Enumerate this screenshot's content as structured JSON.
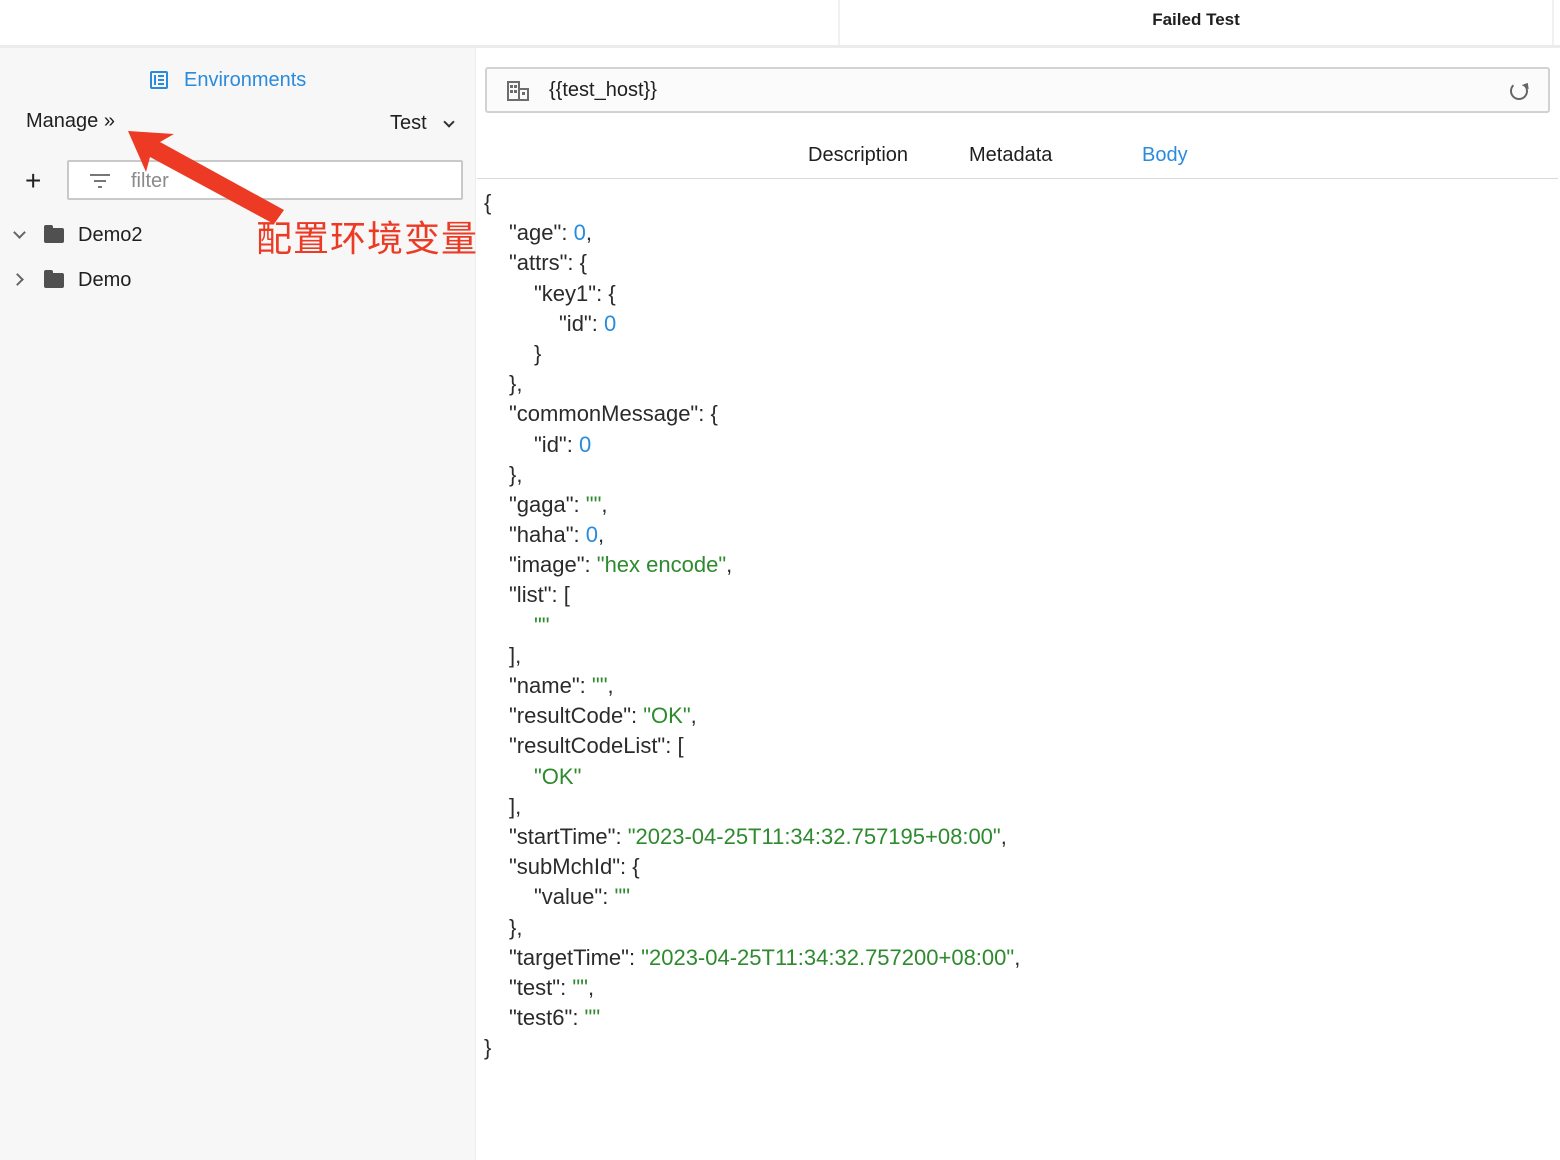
{
  "header": {
    "title": "Failed Test"
  },
  "sidebar": {
    "environments_label": "Environments",
    "manage_label": "Manage »",
    "environment_selected": "Test",
    "add_label": "+",
    "filter_placeholder": "filter",
    "tree": [
      {
        "label": "Demo2",
        "expanded": true
      },
      {
        "label": "Demo",
        "expanded": false
      }
    ]
  },
  "annotation": {
    "text": "配置环境变量",
    "color": "#ec3a24"
  },
  "request": {
    "url": "{{test_host}}"
  },
  "tabs": [
    {
      "label": "Description",
      "active": false
    },
    {
      "label": "Metadata",
      "active": false
    },
    {
      "label": "Body",
      "active": true
    }
  ],
  "colors": {
    "accent": "#2a8bdc",
    "string": "#2e8a2e",
    "number": "#2a8bdc"
  },
  "body_lines": [
    {
      "indent": 0,
      "parts": [
        {
          "t": "p",
          "v": "{"
        }
      ]
    },
    {
      "indent": 1,
      "parts": [
        {
          "t": "k",
          "v": "\"age\": "
        },
        {
          "t": "n",
          "v": "0"
        },
        {
          "t": "p",
          "v": ","
        }
      ]
    },
    {
      "indent": 1,
      "parts": [
        {
          "t": "k",
          "v": "\"attrs\": {"
        }
      ]
    },
    {
      "indent": 2,
      "parts": [
        {
          "t": "k",
          "v": "\"key1\": {"
        }
      ]
    },
    {
      "indent": 3,
      "parts": [
        {
          "t": "k",
          "v": "\"id\": "
        },
        {
          "t": "n",
          "v": "0"
        }
      ]
    },
    {
      "indent": 2,
      "parts": [
        {
          "t": "p",
          "v": "}"
        }
      ]
    },
    {
      "indent": 1,
      "parts": [
        {
          "t": "p",
          "v": "},"
        }
      ]
    },
    {
      "indent": 1,
      "parts": [
        {
          "t": "k",
          "v": "\"commonMessage\": {"
        }
      ]
    },
    {
      "indent": 2,
      "parts": [
        {
          "t": "k",
          "v": "\"id\": "
        },
        {
          "t": "n",
          "v": "0"
        }
      ]
    },
    {
      "indent": 1,
      "parts": [
        {
          "t": "p",
          "v": "},"
        }
      ]
    },
    {
      "indent": 1,
      "parts": [
        {
          "t": "k",
          "v": "\"gaga\": "
        },
        {
          "t": "s",
          "v": "\"\""
        },
        {
          "t": "p",
          "v": ","
        }
      ]
    },
    {
      "indent": 1,
      "parts": [
        {
          "t": "k",
          "v": "\"haha\": "
        },
        {
          "t": "n",
          "v": "0"
        },
        {
          "t": "p",
          "v": ","
        }
      ]
    },
    {
      "indent": 1,
      "parts": [
        {
          "t": "k",
          "v": "\"image\": "
        },
        {
          "t": "s",
          "v": "\"hex encode\""
        },
        {
          "t": "p",
          "v": ","
        }
      ]
    },
    {
      "indent": 1,
      "parts": [
        {
          "t": "k",
          "v": "\"list\": ["
        }
      ]
    },
    {
      "indent": 2,
      "parts": [
        {
          "t": "s",
          "v": "\"\""
        }
      ]
    },
    {
      "indent": 1,
      "parts": [
        {
          "t": "p",
          "v": "],"
        }
      ]
    },
    {
      "indent": 1,
      "parts": [
        {
          "t": "k",
          "v": "\"name\": "
        },
        {
          "t": "s",
          "v": "\"\""
        },
        {
          "t": "p",
          "v": ","
        }
      ]
    },
    {
      "indent": 1,
      "parts": [
        {
          "t": "k",
          "v": "\"resultCode\": "
        },
        {
          "t": "s",
          "v": "\"OK\""
        },
        {
          "t": "p",
          "v": ","
        }
      ]
    },
    {
      "indent": 1,
      "parts": [
        {
          "t": "k",
          "v": "\"resultCodeList\": ["
        }
      ]
    },
    {
      "indent": 2,
      "parts": [
        {
          "t": "s",
          "v": "\"OK\""
        }
      ]
    },
    {
      "indent": 1,
      "parts": [
        {
          "t": "p",
          "v": "],"
        }
      ]
    },
    {
      "indent": 1,
      "parts": [
        {
          "t": "k",
          "v": "\"startTime\": "
        },
        {
          "t": "s",
          "v": "\"2023-04-25T11:34:32.757195+08:00\""
        },
        {
          "t": "p",
          "v": ","
        }
      ]
    },
    {
      "indent": 1,
      "parts": [
        {
          "t": "k",
          "v": "\"subMchId\": {"
        }
      ]
    },
    {
      "indent": 2,
      "parts": [
        {
          "t": "k",
          "v": "\"value\": "
        },
        {
          "t": "s",
          "v": "\"\""
        }
      ]
    },
    {
      "indent": 1,
      "parts": [
        {
          "t": "p",
          "v": "},"
        }
      ]
    },
    {
      "indent": 1,
      "parts": [
        {
          "t": "k",
          "v": "\"targetTime\": "
        },
        {
          "t": "s",
          "v": "\"2023-04-25T11:34:32.757200+08:00\""
        },
        {
          "t": "p",
          "v": ","
        }
      ]
    },
    {
      "indent": 1,
      "parts": [
        {
          "t": "k",
          "v": "\"test\": "
        },
        {
          "t": "s",
          "v": "\"\""
        },
        {
          "t": "p",
          "v": ","
        }
      ]
    },
    {
      "indent": 1,
      "parts": [
        {
          "t": "k",
          "v": "\"test6\": "
        },
        {
          "t": "s",
          "v": "\"\""
        }
      ]
    },
    {
      "indent": 0,
      "parts": [
        {
          "t": "p",
          "v": "}"
        }
      ]
    }
  ]
}
